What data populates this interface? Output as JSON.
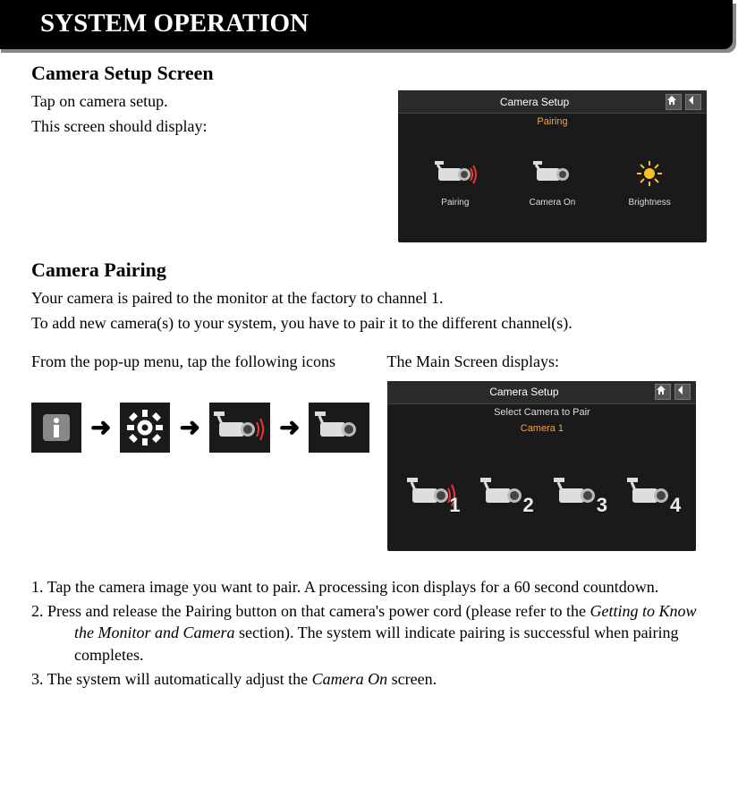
{
  "header": {
    "title": "SYSTEM OPERATION"
  },
  "section1": {
    "heading": "Camera Setup Screen",
    "line1": "Tap on camera setup.",
    "line2": "This screen should display:",
    "screenshot": {
      "title": "Camera Setup",
      "subtitle": "Pairing",
      "tile1": "Pairing",
      "tile2": "Camera On",
      "tile3": "Brightness"
    }
  },
  "section2": {
    "heading": "Camera Pairing",
    "line1": "Your camera is paired to the monitor at the factory to channel 1.",
    "line2": "To add new camera(s) to your system, you have to pair it to the different channel(s).",
    "left": "From the pop-up menu, tap the following icons",
    "right": "The Main Screen displays:",
    "screenshot": {
      "title": "Camera Setup",
      "sub1": "Select Camera to Pair",
      "sub2": "Camera 1",
      "n1": "1",
      "n2": "2",
      "n3": "3",
      "n4": "4"
    },
    "arrow": "➜"
  },
  "steps": {
    "s1_pre": "1. Tap the camera image you want to pair. A processing icon displays for a 60 second countdown.",
    "s2_pre": "2. Press and release the Pairing button on that camera's power cord (please refer to the ",
    "s2_it": "Getting to Know the Monitor and Camera",
    "s2_post": " section). The system will indicate pairing is successful when pairing completes.",
    "s3_pre": "3. The system will automatically adjust the ",
    "s3_it": "Camera On",
    "s3_post": " screen."
  }
}
